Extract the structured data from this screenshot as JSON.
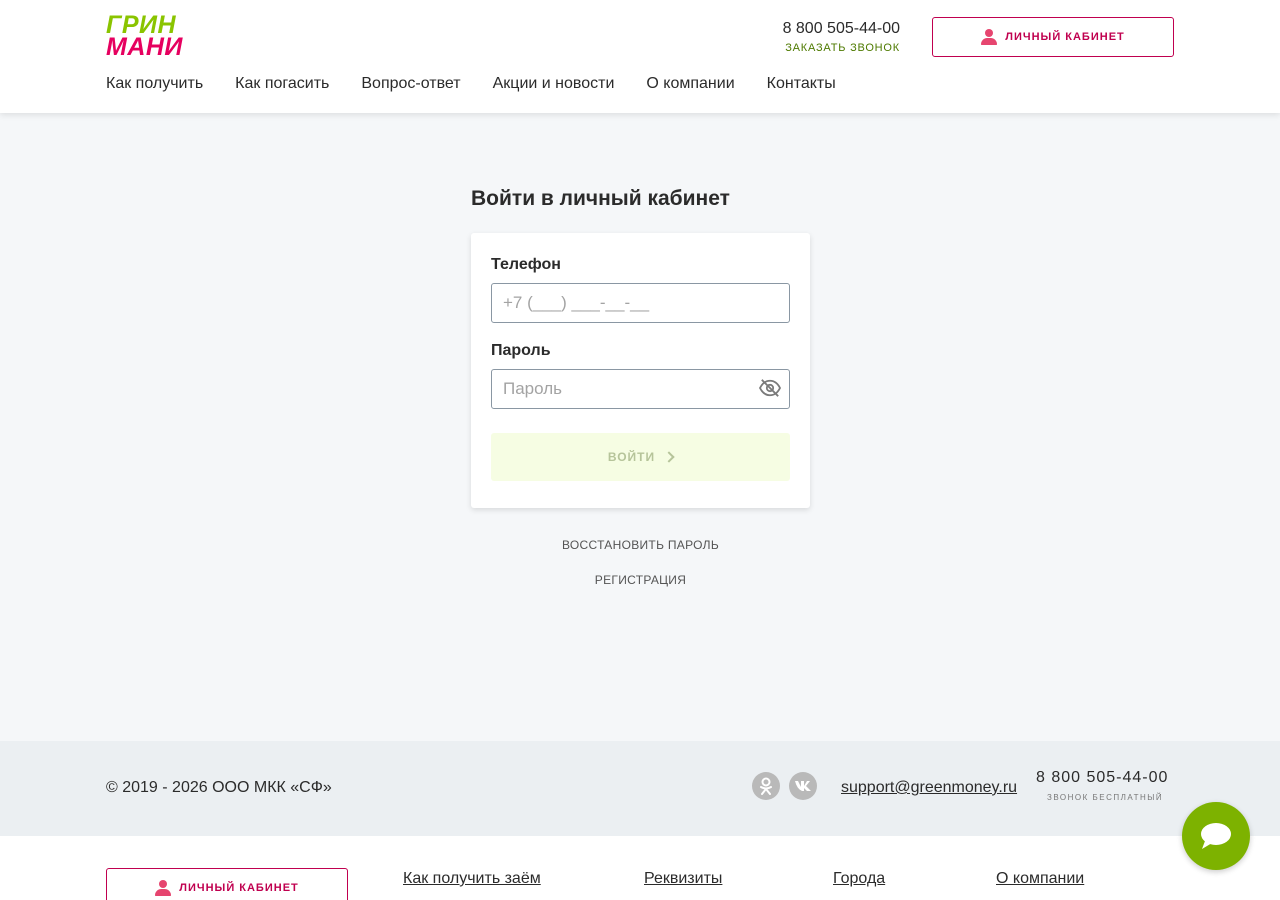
{
  "header": {
    "logo_line1": "ГРИН",
    "logo_line2": "МАНИ",
    "phone": "8 800 505-44-00",
    "callback": "ЗАКАЗАТЬ ЗВОНОК",
    "cabinet_label": "ЛИЧНЫЙ КАБИНЕТ",
    "nav": [
      "Как получить",
      "Как погасить",
      "Вопрос-ответ",
      "Акции и новости",
      "О компании",
      "Контакты"
    ]
  },
  "login": {
    "title": "Войти в личный кабинет",
    "phone_label": "Телефон",
    "phone_placeholder": "+7 (___) ___-__-__",
    "password_label": "Пароль",
    "password_placeholder": "Пароль",
    "submit_label": "ВОЙТИ",
    "restore_label": "ВОССТАНОВИТЬ ПАРОЛЬ",
    "register_label": "РЕГИСТРАЦИЯ"
  },
  "footer": {
    "copyright": "© 2019 - 2026 ООО МКК «СФ»",
    "support_email": "support@greenmoney.ru",
    "phone": "8 800 505-44-00",
    "phone_note": "ЗВОНОК БЕСПЛАТНЫЙ",
    "cabinet_label": "ЛИЧНЫЙ КАБИНЕТ",
    "links": [
      "Как получить заём",
      "Реквизиты",
      "Города",
      "О компании"
    ]
  },
  "colors": {
    "brand_green": "#8ac400",
    "brand_pink": "#e6005f",
    "accent_crimson": "#c0004f",
    "chat_green": "#7db200"
  }
}
